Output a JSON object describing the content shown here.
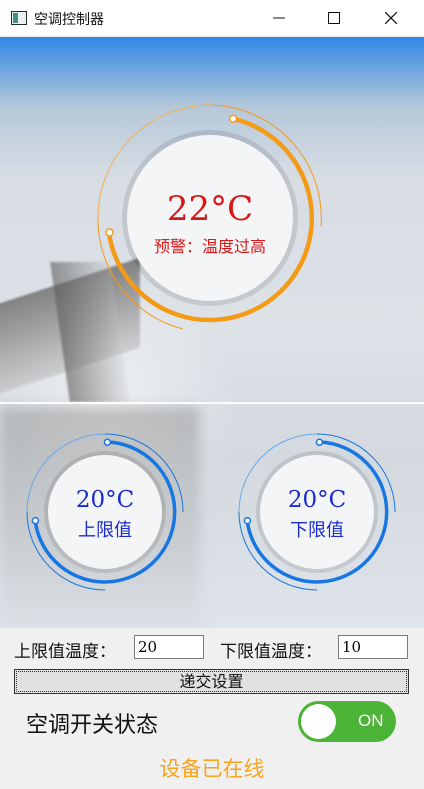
{
  "window": {
    "title": "空调控制器"
  },
  "gauges": {
    "main": {
      "temperature": "22°C",
      "warning": "预警：温度过高"
    },
    "upper": {
      "temperature": "20°C",
      "label": "上限值"
    },
    "lower": {
      "temperature": "20°C",
      "label": "下限值"
    }
  },
  "form": {
    "upper_label": "上限值温度：",
    "upper_value": "20",
    "lower_label": "下限值温度：",
    "lower_value": "10",
    "submit_label": "递交设置"
  },
  "ac_switch": {
    "label": "空调开关状态",
    "state_text": "ON",
    "is_on": true
  },
  "status": {
    "text": "设备已在线"
  },
  "colors": {
    "alarm": "#d81818",
    "limit_text": "#1a2ccf",
    "main_arc": "#f39a17",
    "limit_arc": "#1677e3",
    "toggle_on": "#4bb335",
    "status": "#f5a51e"
  },
  "icons": {
    "app": "app-window-icon",
    "minimize": "minimize-icon",
    "maximize": "maximize-icon",
    "close": "close-icon"
  }
}
